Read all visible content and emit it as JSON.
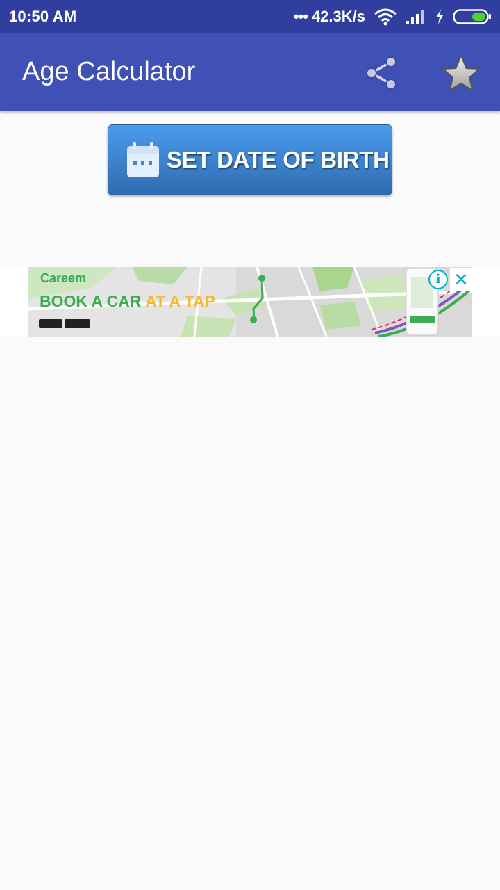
{
  "status_bar": {
    "time": "10:50 AM",
    "network_speed": "42.3K/s",
    "dots": "•••"
  },
  "app_bar": {
    "title": "Age Calculator",
    "share_icon": "share-icon",
    "star_icon": "star-icon"
  },
  "main": {
    "dob_button_label": "SET DATE OF BIRTH",
    "dob_icon": "calendar-icon"
  },
  "ad": {
    "brand": "Careem",
    "headline_part1": "BOOK A CAR ",
    "headline_part2": "AT A TAP",
    "info_icon": "info-icon",
    "close_icon": "close-icon"
  },
  "colors": {
    "status_bar": "#303f9f",
    "app_bar": "#3f51b5",
    "button_top": "#4a9cec",
    "button_bottom": "#2f6cb0",
    "background": "#fafafa",
    "ad_accent": "#00aecd"
  }
}
